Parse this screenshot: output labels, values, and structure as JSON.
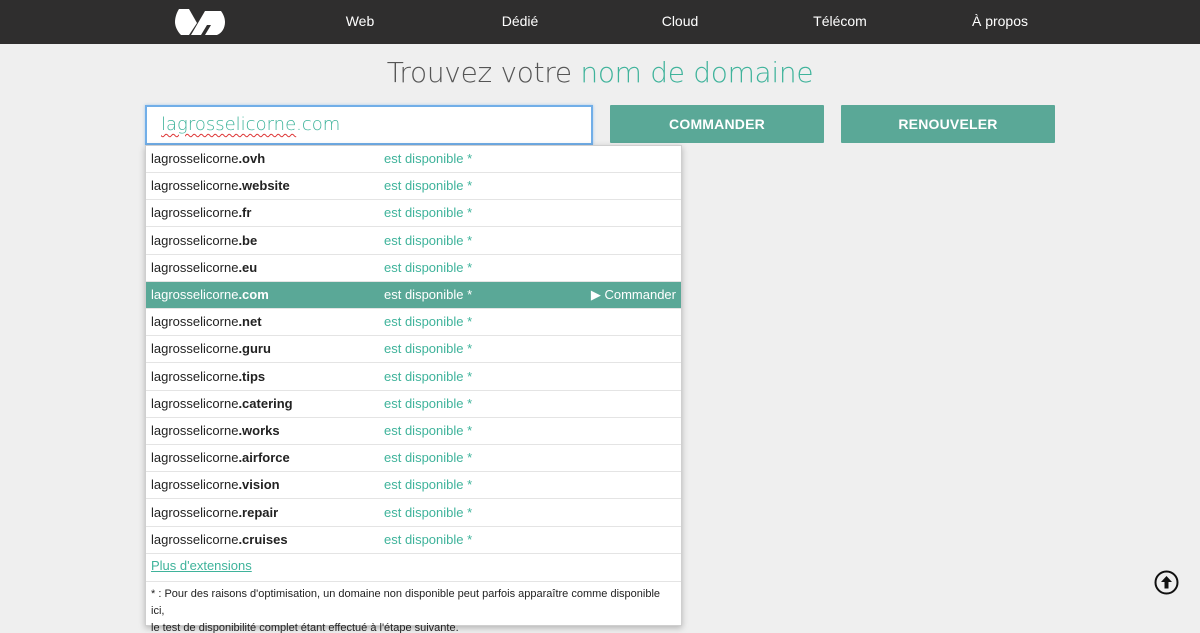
{
  "nav": {
    "logo": "ovh-logo",
    "items": [
      "Web",
      "Dédié",
      "Cloud",
      "Télécom",
      "À propos"
    ]
  },
  "headline": {
    "prefix": "Trouvez votre",
    "accent": "nom de domaine"
  },
  "search": {
    "value_base": "lagrosselicorne",
    "value_ext": ".com"
  },
  "buttons": {
    "order": "COMMANDER",
    "renew": "RENOUVELER"
  },
  "results": [
    {
      "base": "lagrosselicorne",
      "ext": ".ovh",
      "status": "est disponible *",
      "selected": false
    },
    {
      "base": "lagrosselicorne",
      "ext": ".website",
      "status": "est disponible *",
      "selected": false
    },
    {
      "base": "lagrosselicorne",
      "ext": ".fr",
      "status": "est disponible *",
      "selected": false
    },
    {
      "base": "lagrosselicorne",
      "ext": ".be",
      "status": "est disponible *",
      "selected": false
    },
    {
      "base": "lagrosselicorne",
      "ext": ".eu",
      "status": "est disponible *",
      "selected": false
    },
    {
      "base": "lagrosselicorne",
      "ext": ".com",
      "status": "est disponible *",
      "selected": true
    },
    {
      "base": "lagrosselicorne",
      "ext": ".net",
      "status": "est disponible *",
      "selected": false
    },
    {
      "base": "lagrosselicorne",
      "ext": ".guru",
      "status": "est disponible *",
      "selected": false
    },
    {
      "base": "lagrosselicorne",
      "ext": ".tips",
      "status": "est disponible *",
      "selected": false
    },
    {
      "base": "lagrosselicorne",
      "ext": ".catering",
      "status": "est disponible *",
      "selected": false
    },
    {
      "base": "lagrosselicorne",
      "ext": ".works",
      "status": "est disponible *",
      "selected": false
    },
    {
      "base": "lagrosselicorne",
      "ext": ".airforce",
      "status": "est disponible *",
      "selected": false
    },
    {
      "base": "lagrosselicorne",
      "ext": ".vision",
      "status": "est disponible *",
      "selected": false
    },
    {
      "base": "lagrosselicorne",
      "ext": ".repair",
      "status": "est disponible *",
      "selected": false
    },
    {
      "base": "lagrosselicorne",
      "ext": ".cruises",
      "status": "est disponible *",
      "selected": false
    }
  ],
  "row_order_label": "▶ Commander",
  "more_link": "Plus d'extensions",
  "footnote": {
    "line1": "* : Pour des raisons d'optimisation, un domaine non disponible peut parfois apparaître comme disponible ici,",
    "line2": "le test de disponibilité complet étant effectué à l'étape suivante."
  },
  "colors": {
    "accent": "#3fb39b",
    "button": "#5aa897",
    "topbar": "#2f2e2e"
  },
  "icons": {
    "back_to_top": "arrow-up-circle-icon"
  }
}
